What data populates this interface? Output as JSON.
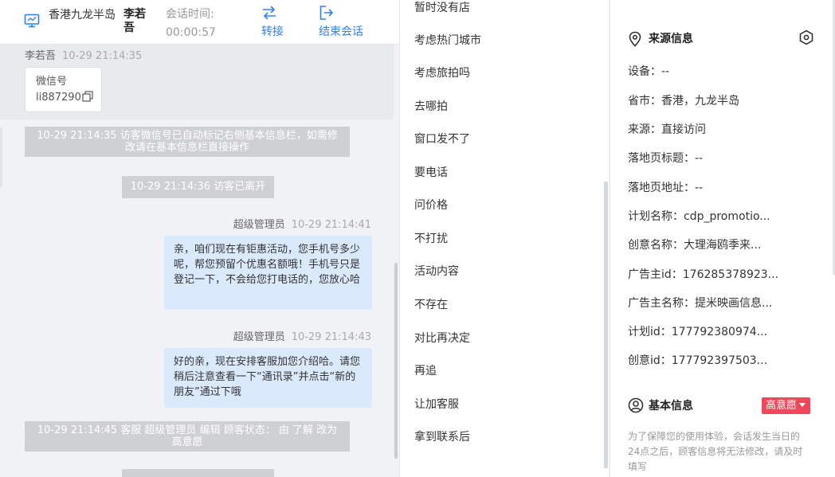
{
  "header": {
    "location": "香港九龙半岛",
    "visitor_name": "李若吾",
    "session_time_label": "会话时间:",
    "session_time_value": "00:00:57",
    "transfer_label": "转接",
    "end_session_label": "结束会话"
  },
  "messages": {
    "visitor_sender": "李若吾",
    "visitor_time": "10-29 21:14:35",
    "wechat_label": "微信号",
    "wechat_id": "li887290",
    "sys1": "10-29 21:14:35 访客微信号已自动标记右侧基本信息栏，如需修改请在基本信息栏直接操作",
    "sys2": "10-29 21:14:36 访客已离开",
    "agent1_sender": "超级管理员",
    "agent1_time": "10-29 21:14:41",
    "agent1_text": "亲，咱们现在有钜惠活动，您手机号多少呢，帮您预留个优惠名额哦！手机号只是登记一下，不会给您打电话的，您放心哈",
    "agent2_sender": "超级管理员",
    "agent2_time": "10-29 21:14:43",
    "agent2_text": "好的亲，现在安排客服加您介绍哈。请您稍后注意查看一下“通讯录”并点击“新的朋友”通过下哦",
    "sys3": "10-29 21:14:45 客服 超级管理员 编辑 顾客状态： 由 了解 改为 高意愿"
  },
  "quick_replies": [
    "暂时没有店",
    "考虑热门城市",
    "考虑旅拍吗",
    "去哪拍",
    "窗口发不了",
    "要电话",
    "问价格",
    "不打扰",
    "活动内容",
    "不存在",
    "对比再决定",
    "再追",
    "让加客服",
    "拿到联系后"
  ],
  "source_info": {
    "title": "来源信息",
    "rows": [
      "设备：--",
      "省市：香港，九龙半岛",
      "来源：直接访问",
      "落地页标题：--",
      "落地页地址：--",
      "计划名称：cdp_promotio...",
      "创意名称：大理海鸥季来...",
      "广告主id：176285378923...",
      "广告主名称：提米映画信息...",
      "计划id：177792380974...",
      "创意id：177792397503..."
    ]
  },
  "basic_info": {
    "title": "基本信息",
    "intent_badge": "高意愿",
    "notice": "为了保障您的使用体验，会话发生当日的24点之后，顾客信息将无法修改，请及时填写"
  },
  "colors": {
    "accent": "#2f80ed",
    "bubble": "#dbe9fd",
    "system_msg": "#cfd0d3",
    "badge_red": "#f0485a"
  }
}
